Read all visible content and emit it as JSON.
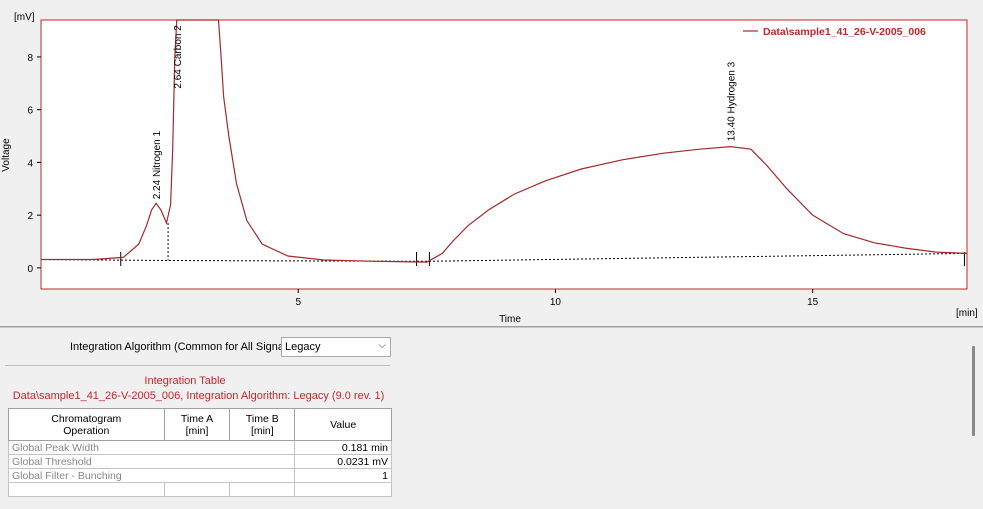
{
  "chart": {
    "y_unit": "[mV]",
    "ylabel": "Voltage",
    "xlabel": "Time",
    "x_unit": "[min]",
    "x_ticks": [
      "5",
      "10",
      "15"
    ],
    "y_ticks": [
      "0",
      "2",
      "4",
      "6",
      "8"
    ],
    "legend": "Data\\sample1_41_26-V-2005_006",
    "peaks": [
      {
        "label": "2.24 Nitrogen  1"
      },
      {
        "label": "2.64 Carbon  2"
      },
      {
        "label": "13.40 Hydrogen  3"
      }
    ],
    "colors": {
      "trace": "#a32a2a",
      "frame": "#c0282c",
      "baseline": "#000000"
    }
  },
  "chart_data": {
    "type": "line",
    "xlabel": "Time",
    "ylabel": "Voltage",
    "x_unit": "min",
    "y_unit": "mV",
    "xlim": [
      0,
      18
    ],
    "ylim": [
      -0.8,
      9.4
    ],
    "series": [
      {
        "name": "Data\\sample1_41_26-V-2005_006",
        "x": [
          0,
          1.0,
          1.6,
          1.9,
          2.05,
          2.15,
          2.24,
          2.33,
          2.44,
          2.52,
          2.56,
          2.6,
          2.64,
          2.7,
          2.9,
          3.2,
          3.45,
          3.5,
          3.55,
          3.65,
          3.8,
          4.0,
          4.3,
          4.8,
          5.5,
          6.5,
          7.5,
          7.8,
          8.0,
          8.3,
          8.7,
          9.2,
          9.8,
          10.5,
          11.3,
          12.1,
          12.8,
          13.4,
          13.8,
          14.1,
          14.5,
          15.0,
          15.6,
          16.2,
          16.8,
          17.4,
          18.0
        ],
        "y": [
          0.32,
          0.32,
          0.4,
          0.9,
          1.6,
          2.2,
          2.45,
          2.2,
          1.7,
          2.4,
          4.5,
          8.0,
          9.4,
          9.4,
          9.4,
          9.4,
          9.4,
          8.0,
          6.5,
          5.0,
          3.2,
          1.8,
          0.9,
          0.45,
          0.3,
          0.25,
          0.22,
          0.55,
          1.0,
          1.6,
          2.2,
          2.8,
          3.3,
          3.75,
          4.1,
          4.35,
          4.5,
          4.6,
          4.5,
          3.9,
          3.0,
          2.0,
          1.3,
          0.95,
          0.75,
          0.6,
          0.55
        ]
      },
      {
        "name": "baseline",
        "x": [
          0,
          2.45,
          7.5,
          12.0,
          18.0
        ],
        "y": [
          0.32,
          0.28,
          0.25,
          0.38,
          0.55
        ]
      }
    ],
    "peaks": [
      {
        "time": 2.24,
        "name": "Nitrogen",
        "number": 1
      },
      {
        "time": 2.64,
        "name": "Carbon",
        "number": 2
      },
      {
        "time": 13.4,
        "name": "Hydrogen",
        "number": 3
      }
    ]
  },
  "integration": {
    "algo_label": "Integration Algorithm (Common for All Signals)",
    "algo_value": "Legacy",
    "table_title": "Integration Table",
    "table_subtitle": "Data\\sample1_41_26-V-2005_006, Integration Algorithm: Legacy (9.0 rev. 1)",
    "headers": {
      "op_line1": "Chromatogram",
      "op_line2": "Operation",
      "timea_line1": "Time A",
      "timea_line2": "[min]",
      "timeb_line1": "Time B",
      "timeb_line2": "[min]",
      "value": "Value"
    },
    "rows": [
      {
        "op": "Global Peak Width",
        "value": "0.181 min"
      },
      {
        "op": "Global Threshold",
        "value": "0.0231 mV"
      },
      {
        "op": "Global Filter - Bunching",
        "value": "1"
      }
    ]
  }
}
